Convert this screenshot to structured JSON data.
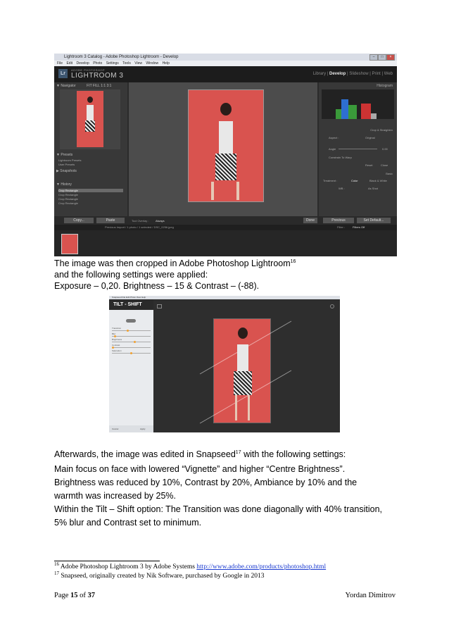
{
  "lightroom": {
    "window_title": "Lightroom 3 Catalog - Adobe Photoshop Lightroom - Develop",
    "menu": [
      "File",
      "Edit",
      "Develop",
      "Photo",
      "Settings",
      "Tools",
      "View",
      "Window",
      "Help"
    ],
    "brand_small": "ADOBE PHOTOSHOP",
    "brand": "LIGHTROOM 3",
    "modules": [
      "Library",
      "Develop",
      "Slideshow",
      "Print",
      "Web"
    ],
    "active_module": "Develop",
    "left_panels": {
      "navigator": "Navigator",
      "navigator_zoom": "FIT  FILL  1:1  3:1",
      "presets": "Presets",
      "preset_items": [
        "Lightroom Presets",
        "User Presets"
      ],
      "snapshots": "Snapshots",
      "history": "History",
      "history_items": [
        "Crop Rectangle",
        "Crop Rectangle",
        "Crop Rectangle",
        "Crop Rectangle"
      ]
    },
    "right_panels": {
      "histogram": "Histogram",
      "crop_tool": "Crop & Straighten",
      "aspect": "Aspect :",
      "aspect_value": "Original",
      "angle": "Angle",
      "angle_value": "0.00",
      "constrain": "Constrain To Warp",
      "reset": "Reset",
      "close": "Close",
      "basic": "Basic",
      "treatment": "Treatment :",
      "color": "Color",
      "bw": "Black & White",
      "wb": "WB :",
      "wb_value": "As Shot"
    },
    "toolbar": {
      "copy": "Copy...",
      "paste": "Paste",
      "tool_overlay": "Tool Overlay :",
      "tool_overlay_value": "Always",
      "done": "Done",
      "previous": "Previous",
      "reset": "Set Default..."
    },
    "filmstrip_path": "Previous Import / 1 photo / 1 selected / DSC_0256.jpeg",
    "filter": "Filter :",
    "filter_value": "Filters Off"
  },
  "snapseed": {
    "window_title": "Snapseed",
    "menu": "File  Edit  Photo  View  Help",
    "tool": "TILT - SHIFT",
    "sliders": [
      "Transition",
      "Blur",
      "Brightness",
      "Contrast",
      "Saturation"
    ],
    "slider_levels": [
      0.4,
      0.05,
      0.6,
      0.0,
      0.5
    ],
    "cancel": "Cancel",
    "apply": "Apply"
  },
  "body": {
    "p1_line1": "The image was then cropped in Adobe Photoshop Lightroom",
    "p1_sup": "16",
    "p1_line2": "and the following settings were applied:",
    "p1_line3": "Exposure – 0,20. Brightness – 15 & Contrast – (-88).",
    "p2_line1": "Afterwards, the image was edited in Snapseed",
    "p2_sup": "17",
    "p2_line1_end": " with the following settings:",
    "p2_line2": "Main focus on face with lowered “Vignette” and higher “Centre Brightness”.",
    "p2_line3": "Brightness was reduced by 10%, Contrast by 20%, Ambiance by 10% and the",
    "p2_line4": "warmth was increased by 25%.",
    "p2_line5": "Within the Tilt – Shift option: The Transition was done diagonally with 40% transition,",
    "p2_line6": "5% blur and Contrast set to minimum."
  },
  "footnotes": [
    {
      "num": "16",
      "text": " Adobe Photoshop Lightroom 3 by Adobe Systems ",
      "link": "http://www.adobe.com/products/photoshop.html"
    },
    {
      "num": "17",
      "text": " Snapseed, originally created by Nik Software, purchased by Google in 2013",
      "link": ""
    }
  ],
  "footer": {
    "page_label": "Page ",
    "page_num": "15",
    "page_of": " of ",
    "page_total": "37",
    "author": "Yordan Dimitrov"
  }
}
